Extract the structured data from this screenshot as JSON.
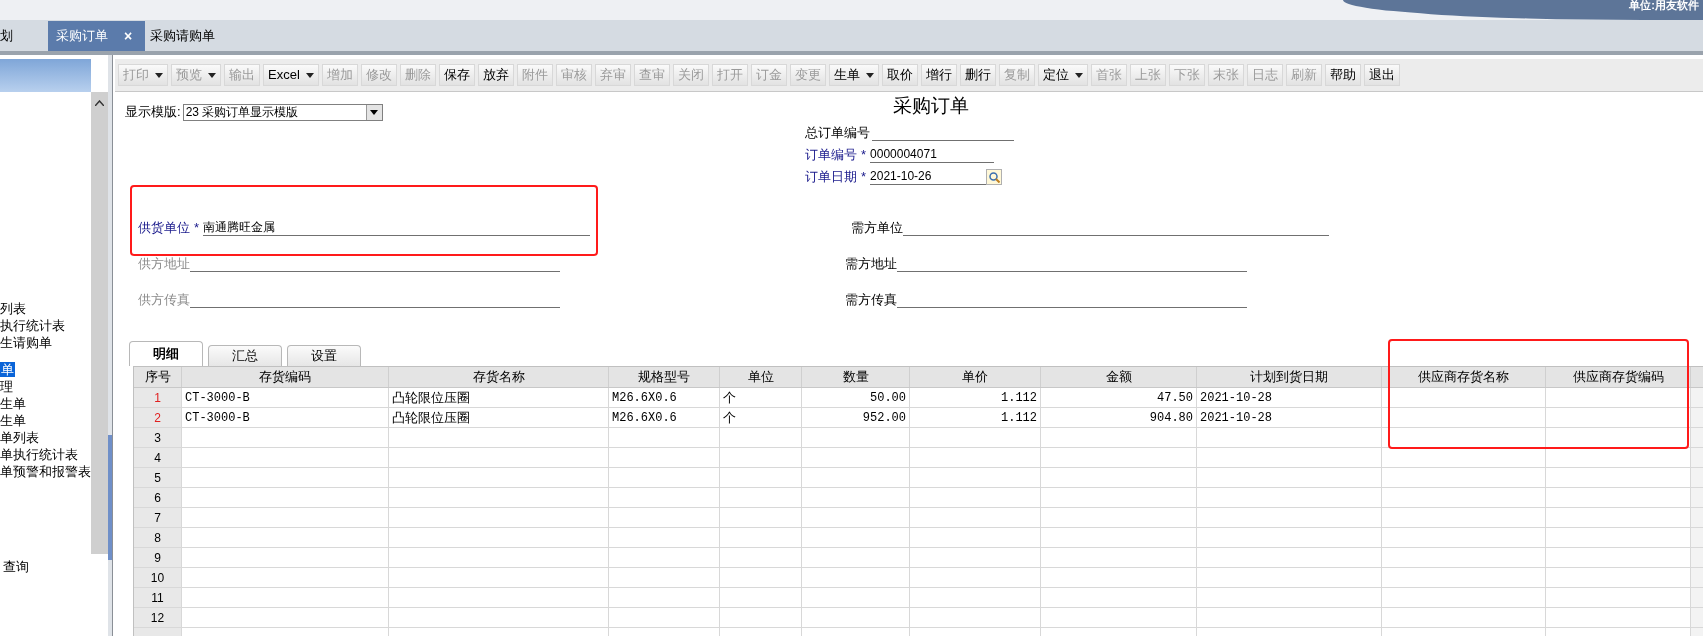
{
  "header": {
    "company": "单位:用友软件"
  },
  "doc_tabs": [
    {
      "label": "划",
      "selected": false
    },
    {
      "label": "采购订单",
      "selected": true,
      "close": "×"
    },
    {
      "label": "采购请购单",
      "selected": false
    }
  ],
  "sidebar": {
    "items": [
      {
        "label": "列表",
        "selected": false
      },
      {
        "label": "执行统计表",
        "selected": false
      },
      {
        "label": "生请购单",
        "selected": false
      },
      {
        "label": "单",
        "selected": true
      },
      {
        "label": "理",
        "selected": false
      },
      {
        "label": "生单",
        "selected": false
      },
      {
        "label": "生单",
        "selected": false
      },
      {
        "label": "单列表",
        "selected": false
      },
      {
        "label": "单执行统计表",
        "selected": false
      },
      {
        "label": "单预警和报警表",
        "selected": false
      },
      {
        "label": "查询",
        "selected": false
      }
    ]
  },
  "toolbar": [
    {
      "label": "打印",
      "enabled": false,
      "dropdown": true
    },
    {
      "label": "预览",
      "enabled": false,
      "dropdown": true
    },
    {
      "label": "输出",
      "enabled": false,
      "dropdown": false
    },
    {
      "label": "Excel",
      "enabled": true,
      "dropdown": true
    },
    {
      "label": "增加",
      "enabled": false,
      "dropdown": false
    },
    {
      "label": "修改",
      "enabled": false,
      "dropdown": false
    },
    {
      "label": "删除",
      "enabled": false,
      "dropdown": false
    },
    {
      "label": "保存",
      "enabled": true,
      "dropdown": false
    },
    {
      "label": "放弃",
      "enabled": true,
      "dropdown": false
    },
    {
      "label": "附件",
      "enabled": false,
      "dropdown": false
    },
    {
      "label": "审核",
      "enabled": false,
      "dropdown": false
    },
    {
      "label": "弃审",
      "enabled": false,
      "dropdown": false
    },
    {
      "label": "查审",
      "enabled": false,
      "dropdown": false
    },
    {
      "label": "关闭",
      "enabled": false,
      "dropdown": false
    },
    {
      "label": "打开",
      "enabled": false,
      "dropdown": false
    },
    {
      "label": "订金",
      "enabled": false,
      "dropdown": false
    },
    {
      "label": "变更",
      "enabled": false,
      "dropdown": false
    },
    {
      "label": "生单",
      "enabled": true,
      "dropdown": true
    },
    {
      "label": "取价",
      "enabled": true,
      "dropdown": false
    },
    {
      "label": "增行",
      "enabled": true,
      "dropdown": false
    },
    {
      "label": "删行",
      "enabled": true,
      "dropdown": false
    },
    {
      "label": "复制",
      "enabled": false,
      "dropdown": false
    },
    {
      "label": "定位",
      "enabled": true,
      "dropdown": true
    },
    {
      "label": "首张",
      "enabled": false,
      "dropdown": false
    },
    {
      "label": "上张",
      "enabled": false,
      "dropdown": false
    },
    {
      "label": "下张",
      "enabled": false,
      "dropdown": false
    },
    {
      "label": "末张",
      "enabled": false,
      "dropdown": false
    },
    {
      "label": "日志",
      "enabled": false,
      "dropdown": false
    },
    {
      "label": "刷新",
      "enabled": false,
      "dropdown": false
    },
    {
      "label": "帮助",
      "enabled": true,
      "dropdown": false
    },
    {
      "label": "退出",
      "enabled": true,
      "dropdown": false
    }
  ],
  "form": {
    "title": "采购订单",
    "template": {
      "label": "显示模版:",
      "value": "23 采购订单显示模版"
    },
    "header_fields": [
      {
        "label": "总订单编号",
        "required": false
      },
      {
        "label": "订单编号",
        "required": true,
        "marker": "*",
        "value": "0000004071"
      },
      {
        "label": "订单日期",
        "required": true,
        "marker": "*",
        "value": "2021-10-26",
        "lookup": true
      }
    ],
    "rows": [
      [
        {
          "label": "供货单位",
          "required": true,
          "marker": "*",
          "value": "南通腾旺金属",
          "disabled": false
        },
        {
          "label": "需方单位",
          "required": false,
          "disabled": false
        }
      ],
      [
        {
          "label": "供方地址",
          "disabled": true
        },
        {
          "label": "需方地址",
          "required": false,
          "disabled": false
        }
      ],
      [
        {
          "label": "供方传真",
          "disabled": true
        },
        {
          "label": "需方传真",
          "required": false,
          "disabled": false
        }
      ]
    ]
  },
  "detail_tabs": [
    {
      "label": "明细",
      "selected": true
    },
    {
      "label": "汇总",
      "selected": false
    },
    {
      "label": "设置",
      "selected": false
    }
  ],
  "table": {
    "columns": [
      "序号",
      "存货编码",
      "存货名称",
      "规格型号",
      "单位",
      "数量",
      "单价",
      "金额",
      "计划到货日期",
      "供应商存货名称",
      "供应商存货编码"
    ],
    "rows": [
      [
        "1",
        "CT-3000-B",
        "凸轮限位压圈",
        "M26.6X0.6",
        "个",
        "50.00",
        "1.112",
        "47.50",
        "2021-10-28",
        "",
        ""
      ],
      [
        "2",
        "CT-3000-B",
        "凸轮限位压圈",
        "M26.6X0.6",
        "个",
        "952.00",
        "1.112",
        "904.80",
        "2021-10-28",
        "",
        ""
      ],
      [
        "3"
      ],
      [
        "4"
      ],
      [
        "5"
      ],
      [
        "6"
      ],
      [
        "7"
      ],
      [
        "8"
      ],
      [
        "9"
      ],
      [
        "10"
      ],
      [
        "11"
      ],
      [
        "12"
      ]
    ]
  }
}
